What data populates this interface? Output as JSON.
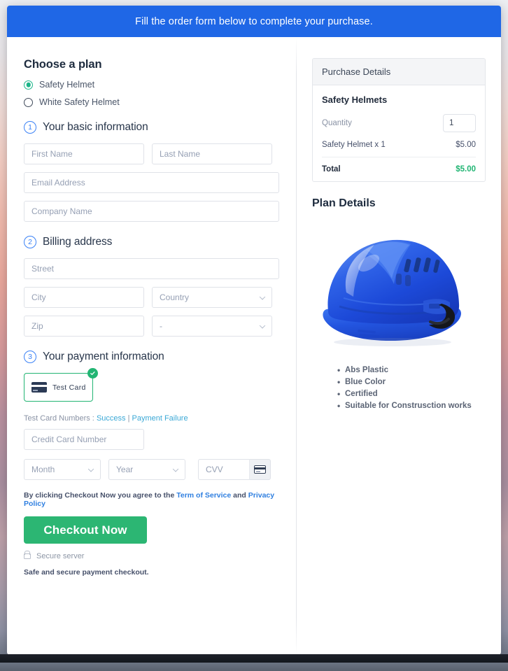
{
  "banner": {
    "text": "Fill the order form below to complete your purchase."
  },
  "plan": {
    "title": "Choose a plan",
    "options": [
      {
        "label": "Safety Helmet",
        "selected": true
      },
      {
        "label": "White Safety Helmet",
        "selected": false
      }
    ]
  },
  "steps": {
    "basic": {
      "num": "1",
      "title": "Your basic information"
    },
    "billing": {
      "num": "2",
      "title": "Billing address"
    },
    "payment": {
      "num": "3",
      "title": "Your payment information"
    }
  },
  "fields": {
    "first_name": {
      "placeholder": "First Name",
      "value": ""
    },
    "last_name": {
      "placeholder": "Last Name",
      "value": ""
    },
    "email": {
      "placeholder": "Email Address",
      "value": ""
    },
    "company": {
      "placeholder": "Company Name",
      "value": ""
    },
    "street": {
      "placeholder": "Street",
      "value": ""
    },
    "city": {
      "placeholder": "City",
      "value": ""
    },
    "country": {
      "value": "Country"
    },
    "zip": {
      "placeholder": "Zip",
      "value": ""
    },
    "state": {
      "value": "-"
    },
    "credit_card": {
      "placeholder": "Credit Card Number",
      "value": ""
    },
    "month": {
      "value": "Month"
    },
    "year": {
      "value": "Year"
    },
    "cvv": {
      "placeholder": "CVV",
      "value": ""
    }
  },
  "payment": {
    "card_tile_label": "Test Card",
    "card_icon": "credit-card-icon",
    "selected_badge_icon": "check-circle-icon",
    "test_numbers_prefix": "Test Card Numbers :",
    "success_link": "Success",
    "separator": "|",
    "failure_link": "Payment Failure",
    "cvv_icon": "credit-card-icon"
  },
  "footer": {
    "terms_prefix": "By clicking Checkout Now you agree to the",
    "terms_link": "Term of Service",
    "terms_and": "and",
    "privacy_link": "Privacy Policy",
    "checkout_label": "Checkout Now",
    "secure_icon": "lock-icon",
    "secure_text": "Secure server",
    "safe_text": "Safe and secure payment checkout."
  },
  "purchase": {
    "header": "Purchase Details",
    "product_name": "Safety Helmets",
    "quantity_label": "Quantity",
    "quantity_value": "1",
    "line_item_label": "Safety Helmet x 1",
    "line_item_amount": "$5.00",
    "total_label": "Total",
    "total_amount": "$5.00"
  },
  "plan_details": {
    "title": "Plan Details",
    "image": "blue-safety-helmet-image",
    "features": [
      "Abs Plastic",
      "Blue Color",
      "Certified",
      "Suitable for Construsction works"
    ]
  },
  "colors": {
    "banner_blue": "#1f67e6",
    "accent_green": "#2cb673",
    "radio_green": "#1bb589",
    "link_blue": "#2f7fe0",
    "test_link": "#3aa8d6",
    "step_blue": "#3b82f6",
    "total_green": "#21b573"
  }
}
